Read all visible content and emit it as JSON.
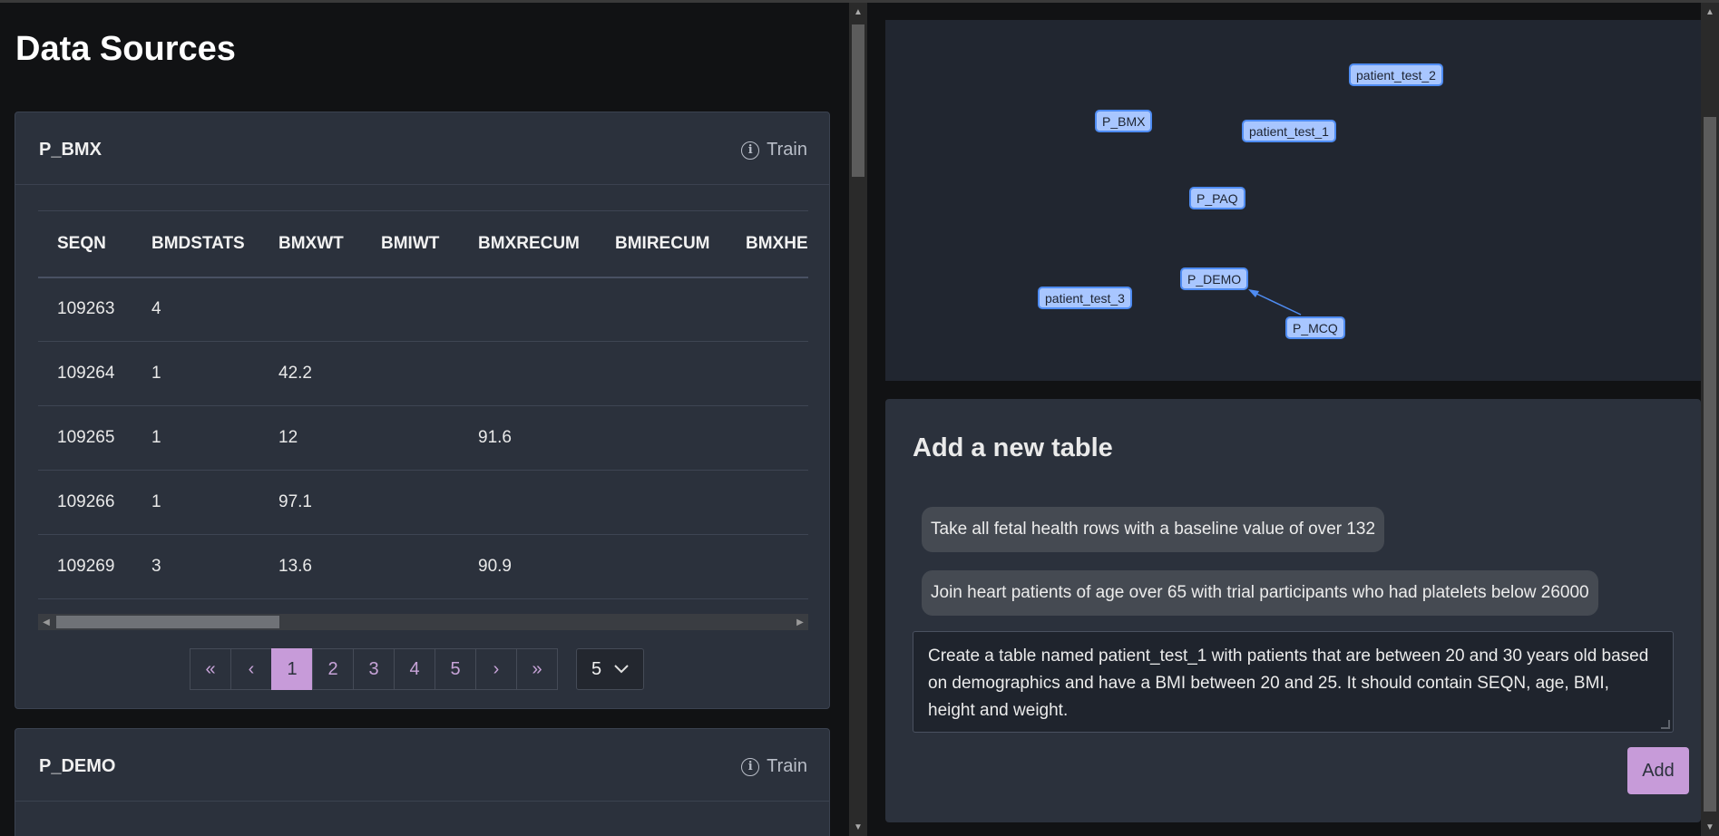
{
  "page": {
    "title": "Data Sources"
  },
  "cards": [
    {
      "title": "P_BMX",
      "train_label": "Train",
      "columns": [
        "SEQN",
        "BMDSTATS",
        "BMXWT",
        "BMIWT",
        "BMXRECUM",
        "BMIRECUM",
        "BMXHE"
      ],
      "rows": [
        [
          "109263",
          "4",
          "",
          "",
          "",
          "",
          ""
        ],
        [
          "109264",
          "1",
          "42.2",
          "",
          "",
          "",
          ""
        ],
        [
          "109265",
          "1",
          "12",
          "",
          "91.6",
          "",
          ""
        ],
        [
          "109266",
          "1",
          "97.1",
          "",
          "",
          "",
          ""
        ],
        [
          "109269",
          "3",
          "13.6",
          "",
          "90.9",
          "",
          ""
        ]
      ],
      "pagination": {
        "first": "«",
        "prev": "‹",
        "pages": [
          "1",
          "2",
          "3",
          "4",
          "5"
        ],
        "current": 1,
        "next": "›",
        "last": "»",
        "page_size": "5"
      }
    },
    {
      "title": "P_DEMO",
      "train_label": "Train"
    }
  ],
  "graph": {
    "nodes": [
      "patient_test_2",
      "P_BMX",
      "patient_test_1",
      "P_PAQ",
      "P_DEMO",
      "patient_test_3",
      "P_MCQ"
    ],
    "edges": [
      {
        "from": "P_MCQ",
        "to": "P_DEMO"
      }
    ]
  },
  "new_table": {
    "title": "Add a new table",
    "suggestions": [
      "Take all fetal health rows with a baseline value of over 132",
      "Join heart patients of age over 65 with trial participants who had platelets below 26000"
    ],
    "query_value": "Create a table named patient_test_1 with patients that are between 20 and 30 years old based on demographics and have a BMI between 20 and 25. It should contain SEQN, age, BMI, height and weight.",
    "add_label": "Add"
  },
  "colors": {
    "accent": "#c79bd9",
    "node_fill": "#a8c6ff",
    "node_border": "#4f8cf2",
    "card_bg": "#2b313c"
  }
}
